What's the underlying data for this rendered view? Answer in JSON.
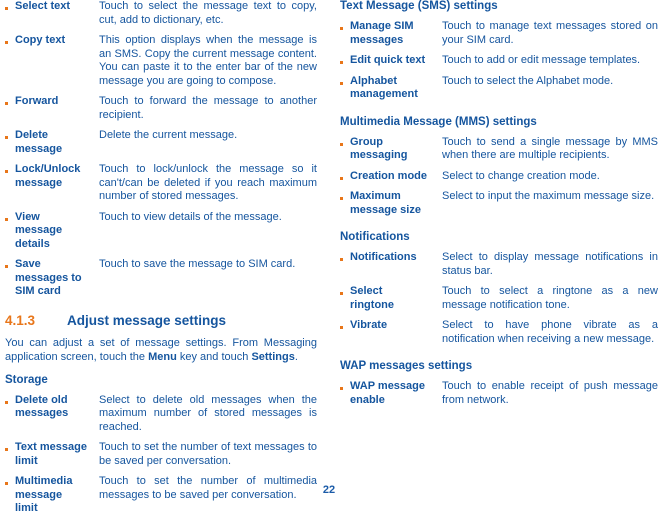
{
  "page": {
    "number": "22",
    "colors": {
      "text_blue": "#15559e",
      "accent_orange": "#e8761a"
    }
  },
  "left_column": {
    "message_options": [
      {
        "term": "Select text",
        "desc": "Touch to select the message text to copy, cut, add to dictionary, etc."
      },
      {
        "term": "Copy text",
        "desc": "This option displays when the message is an SMS. Copy the current message content. You can paste it to the enter bar of the new message you are going to compose."
      },
      {
        "term": "Forward",
        "desc": "Touch to forward the message to another recipient."
      },
      {
        "term": "Delete message",
        "desc": "Delete the current message."
      },
      {
        "term": "Lock/Unlock message",
        "desc": "Touch to lock/unlock the message so it can't/can be deleted if you reach maximum number of stored messages."
      },
      {
        "term": "View message details",
        "desc": "Touch to view details of the message."
      },
      {
        "term": "Save messages to SIM card",
        "desc": "Touch to save the message to SIM card."
      }
    ],
    "section": {
      "number": "4.1.3",
      "title": "Adjust message settings",
      "paragraph_prefix": "You can adjust a set of message settings. From Messaging application screen, touch the ",
      "paragraph_bold_1": "Menu",
      "paragraph_middle": " key and touch ",
      "paragraph_bold_2": "Settings",
      "paragraph_suffix": "."
    },
    "storage": {
      "heading": "Storage",
      "items": [
        {
          "term": "Delete old messages",
          "desc": "Select to delete old messages when the maximum number of stored messages is reached."
        },
        {
          "term": "Text message limit",
          "desc": "Touch to set the number of text messages to be saved per conversation."
        },
        {
          "term": "Multimedia message limit",
          "desc": "Touch to set the number of multimedia messages to be saved per conversation."
        }
      ]
    }
  },
  "right_column": {
    "sms": {
      "heading": "Text Message (SMS) settings",
      "items": [
        {
          "term": "Manage SIM messages",
          "desc": "Touch to manage text messages stored on your SIM card."
        },
        {
          "term": "Edit quick text",
          "desc": "Touch to add or edit message templates."
        },
        {
          "term": "Alphabet management",
          "desc": "Touch to select the Alphabet mode."
        }
      ]
    },
    "mms": {
      "heading": "Multimedia Message (MMS) settings",
      "items": [
        {
          "term": "Group messaging",
          "desc": "Touch to send a single message by MMS when there are multiple recipients."
        },
        {
          "term": "Creation mode",
          "desc": "Select to change creation mode."
        },
        {
          "term": "Maximum message size",
          "desc": "Select to input the maximum message size."
        }
      ]
    },
    "notifications": {
      "heading": "Notifications",
      "items": [
        {
          "term": "Notifications",
          "desc": "Select to display message notifications in status bar."
        },
        {
          "term": "Select ringtone",
          "desc": "Touch to select a ringtone as a new message notification tone."
        },
        {
          "term": "Vibrate",
          "desc": "Select to have phone vibrate as a notification when receiving a new message."
        }
      ]
    },
    "wap": {
      "heading": "WAP messages settings",
      "items": [
        {
          "term": "WAP message enable",
          "desc": "Touch to enable receipt of push message from network."
        }
      ]
    }
  }
}
